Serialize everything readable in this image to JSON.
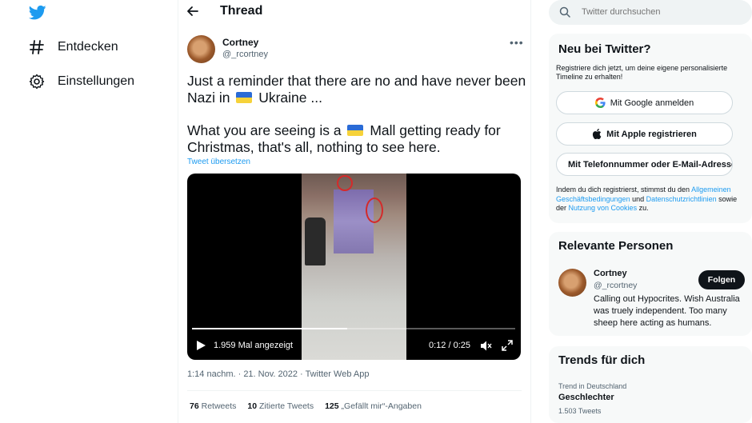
{
  "nav": {
    "explore_label": "Entdecken",
    "settings_label": "Einstellungen"
  },
  "header": {
    "title": "Thread"
  },
  "tweet": {
    "author_name": "Cortney",
    "author_handle": "@_rcortney",
    "lines": [
      {
        "before": "Just a reminder that there are no and have never been",
        "after": ""
      },
      {
        "before": "Nazi in ",
        "after": " Ukraine ..."
      },
      {
        "before": "What you are seeing is a ",
        "after": " Mall getting ready for"
      },
      {
        "before": "Christmas, that's all, nothing to see here.",
        "after": ""
      }
    ],
    "translate_label": "Tweet übersetzen",
    "video": {
      "views": "1.959 Mal angezeigt",
      "time": "0:12 / 0:25",
      "progress": 0.48
    },
    "timestamp": "1:14 nachm. · 21. Nov. 2022 · Twitter Web App",
    "stats": {
      "retweets_count": "76",
      "retweets_label": "Retweets",
      "quotes_count": "10",
      "quotes_label": "Zitierte Tweets",
      "likes_count": "125",
      "likes_label": "„Gefällt mir“-Angaben"
    }
  },
  "search": {
    "placeholder": "Twitter durchsuchen"
  },
  "signup": {
    "title": "Neu bei Twitter?",
    "description": "Registriere dich jetzt, um deine eigene personalisierte Timeline zu erhalten!",
    "google_label": "Mit Google anmelden",
    "apple_label": "Mit Apple registrieren",
    "phone_label": "Mit Telefonnummer oder E-Mail-Adresse registrieren",
    "legal_prefix": "Indem du dich registrierst, stimmst du den ",
    "legal_link1": "Allgemeinen Geschäftsbedingungen",
    "legal_mid": " und ",
    "legal_link2": "Datenschutzrichtlinien",
    "legal_mid2": " sowie der ",
    "legal_link3": "Nutzung von Cookies",
    "legal_suffix": " zu."
  },
  "people": {
    "title": "Relevante Personen",
    "name": "Cortney",
    "handle": "@_rcortney",
    "follow_label": "Folgen",
    "bio": "Calling out Hypocrites. Wish Australia was truely independent. Too many sheep here acting as humans."
  },
  "trends": {
    "title": "Trends für dich",
    "context": "Trend in Deutschland",
    "name": "Geschlechter",
    "count": "1.503 Tweets"
  },
  "colors": {
    "accent": "#1d9bf0",
    "text": "#0f1419",
    "muted": "#536471"
  }
}
